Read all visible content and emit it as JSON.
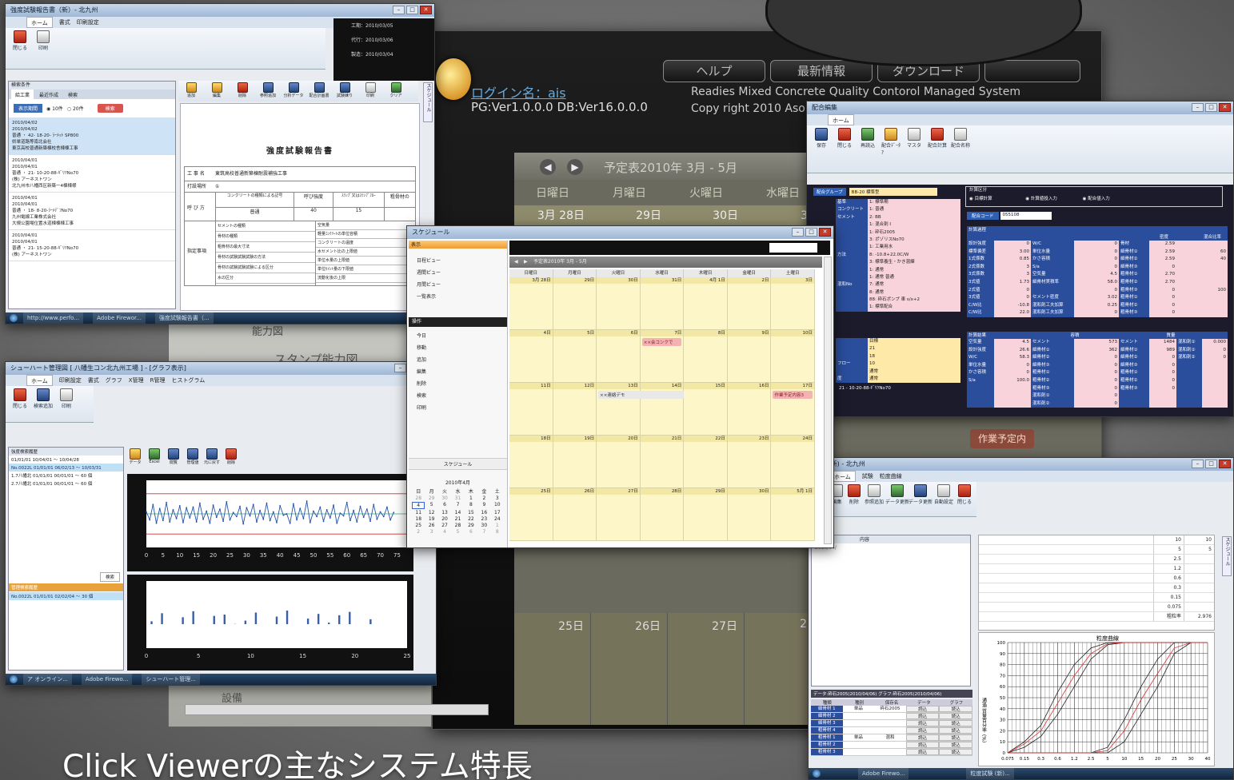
{
  "caption": "Click Viewerの主なシステム特長",
  "main_app": {
    "nav": [
      "ヘルプ",
      "最新情報",
      "ダウンロード"
    ],
    "login": "ログイン名：ais",
    "version": "PG:Ver1.0.0.0 DB:Ver16.0.0.0",
    "system_name": "Readies Mixed Concrete Quality Contorol Managed System",
    "copyright": "Copy right 2010 Aso",
    "schedule_title": "予定表2010年 3月 - 5月",
    "weekdays": [
      "日曜日",
      "月曜日",
      "火曜日",
      "水曜日"
    ],
    "dates_top": [
      "3月 28日",
      "29日",
      "30日",
      "31"
    ],
    "dates_bottom": [
      "25日",
      "26日",
      "27日",
      "28"
    ],
    "stamp_label": "スタンプ能力図",
    "side_label1": "能力図",
    "side_label2": "設備",
    "work_button": "作業予定内"
  },
  "report_win": {
    "title": "強度試験報告書（新）- 北九州",
    "tabs": [
      "ホーム",
      "書式",
      "印刷設定"
    ],
    "btns": [
      "閉じる",
      "印刷"
    ],
    "meta": [
      "工期：2010/03/05",
      "代行：2010/03/06",
      "製造：2010/03/04"
    ],
    "list_tabs": [
      "給工業",
      "最近作成",
      "検索"
    ],
    "filter_btn": "表示期間",
    "radio": [
      "10件",
      "20件"
    ],
    "search": "検索",
    "entries": [
      [
        "2010/04/02",
        "2010/04/02",
        "普通 ・ 42- 18-20- ﾗｰﾒｯﾄ SP800",
        "県単道路等南北会社",
        "東京高校普通新築棟校舎棟棟工事"
      ],
      [
        "2010/04/01",
        "2010/04/01",
        "普通 ・ 21- 10-20-88-ｷﾞﾘﾂNo70",
        "(株) アーネストワン",
        "北九州市八幡西区新築一4棟棟様"
      ],
      [
        "2010/04/01",
        "2010/04/01",
        "普通 ・ 18- 8-20-ﾗｰﾒﾃﾞﾌNo70",
        "九州電線工業株式会社",
        "大規公園場位置水道棟棟棟工事"
      ],
      [
        "2010/04/01",
        "2010/04/01",
        "普通 ・ 21- 15-20-88-ｷﾞﾘﾂNo70",
        "(株) アーネストワン"
      ]
    ],
    "toolbar": [
      "追加",
      "編集",
      "削除",
      "参照追加",
      "分析データ",
      "配合計画書",
      "試験練り",
      "印刷",
      "クリア"
    ],
    "doc_title": "強度試験報告書",
    "rows": [
      [
        "工 事 名",
        "東筑高校普通新築棟耐震補強工事"
      ],
      [
        "打設場所",
        "①"
      ]
    ],
    "col_heads": [
      "コンクリートの種類による記号",
      "呼び強度",
      "ｽﾗﾝﾌﾟ又はｽﾗﾝﾌﾟﾌﾛｰ",
      "粗骨材の"
    ],
    "col_vals": [
      "普通",
      "40",
      "15"
    ],
    "spec_label": "呼 び 方",
    "spec_rows": [
      "セメントの種類",
      "骨材の種類",
      "粗骨材の最大寸法",
      "骨材の試験試験試験の方法",
      "骨材の試験試験試験による区分",
      "水の区分"
    ],
    "spec_rows2": [
      "空気量",
      "軽量ｺﾝｸﾘｰﾄの単位容積",
      "コンクリートの温度",
      "水セメント比の上限値",
      "単位水量の上限値",
      "単位ｾﾒﾝﾄ量の下限値",
      "流動化後の上限"
    ],
    "extra_label": "指定事項",
    "side_tab": "スケジュール",
    "status": [
      "http://www.perfo...",
      "Adobe Firewor...",
      "強度試験報告書（..."
    ]
  },
  "schedule_win": {
    "title": "スケジュール",
    "views": [
      "日程ビュー",
      "週間ビュー",
      "月間ビュー",
      "一覧表示"
    ],
    "ops_label": "操作",
    "ops": [
      "今日",
      "移動",
      "追加",
      "編集",
      "削除",
      "検索",
      "印刷"
    ],
    "schedule_label": "スケジュール",
    "range": "予定表2010年 3月 - 5月",
    "weekdays": [
      "日曜日",
      "月曜日",
      "火曜日",
      "水曜日",
      "木曜日",
      "金曜日",
      "土曜日"
    ],
    "weeks": [
      [
        "3月 28日",
        "29日",
        "30日",
        "31日",
        "4月 1日",
        "2日",
        "3日"
      ],
      [
        "4日",
        "5日",
        "6日",
        "7日",
        "8日",
        "9日",
        "10日"
      ],
      [
        "11日",
        "12日",
        "13日",
        "14日",
        "15日",
        "16日",
        "17日"
      ],
      [
        "18日",
        "19日",
        "20日",
        "21日",
        "22日",
        "23日",
        "24日"
      ],
      [
        "25日",
        "26日",
        "27日",
        "28日",
        "29日",
        "30日",
        "5月 1日"
      ]
    ],
    "events": [
      "××会コンクで",
      "××連絡デモ",
      "作業予定内容3"
    ],
    "mini_month": "2010年4月",
    "mini_head": [
      "日",
      "月",
      "火",
      "水",
      "木",
      "金",
      "土"
    ],
    "mini_days": [
      [
        "28",
        "29",
        "30",
        "31",
        "1",
        "2",
        "3"
      ],
      [
        "4",
        "5",
        "6",
        "7",
        "8",
        "9",
        "10"
      ],
      [
        "11",
        "12",
        "13",
        "14",
        "15",
        "16",
        "17"
      ],
      [
        "18",
        "19",
        "20",
        "21",
        "22",
        "23",
        "24"
      ],
      [
        "25",
        "26",
        "27",
        "28",
        "29",
        "30",
        "1"
      ],
      [
        "2",
        "3",
        "4",
        "5",
        "6",
        "7",
        "8"
      ]
    ]
  },
  "chart_win": {
    "title": "シューハート管理図 [ 八幡生コン北九州工場 ] - [グラフ表示]",
    "tabs": [
      "ホーム",
      "印刷設定",
      "書式",
      "グラフ",
      "X管理",
      "R管理",
      "ヒストグラム"
    ],
    "btns": [
      "閉じる",
      "検索追加",
      "印刷"
    ],
    "panel_title": "強度検索履歴",
    "history": [
      "01/01/01 10/04/01 ～ 10/04/28",
      "No.0022L 01/01/01 06/02/13 ～ 10/03/31",
      "1.7八幡北 01/01/01 00/01/01 ～ 60 個",
      "2.7八幡北 01/01/01 00/01/01 ～ 60 個"
    ],
    "search_btn": "検索",
    "panel2_title": "管理検索履歴",
    "history2": [
      "No.0022L 01/01/01 02/02/04 ～ 30 個"
    ],
    "toolbar": [
      "データ",
      "Excel",
      "閲覧",
      "管理値",
      "元に戻す",
      "削除"
    ],
    "status": [
      "ア オンライン...",
      "Adobe Firewo...",
      "シューハート管理..."
    ]
  },
  "mix_win": {
    "title": "配合編集",
    "tabs": [
      "ホーム"
    ],
    "btns": [
      "保存",
      "閉じる",
      "再読込",
      "配合ﾃﾞｰﾀｱ",
      "マスタ",
      "配合計算",
      "配合名称"
    ],
    "group_label": "配合グループ",
    "group_value": "BB-20 標準型",
    "calc_label": "計算区分",
    "calc_opts": [
      "目標計算",
      "計算値投入力",
      "配合値入力"
    ],
    "code_label": "配合コード",
    "code_value": "055108",
    "left_labels": [
      "基準",
      "コンクリート",
      "セメント",
      "",
      "",
      "",
      "",
      "方法",
      "",
      "",
      "",
      "混和No",
      ""
    ],
    "left_values": [
      "1: 標準期",
      "1: 普通",
      "2: BB",
      "1: 混合剤 I",
      "1: 砕石2005",
      "3: ポゾリスNo70",
      "1: 工業用水",
      "8: -10.8+22.0C/W",
      "3: 標準養生・かき混練",
      "1: 通常",
      "1: 通常 普通",
      "7: 通常",
      "8: 通常",
      "88: 砕石ポンプ 車 s/x+2",
      "1: 標準配合"
    ],
    "lower_labels": [
      "",
      "",
      "",
      "フロー",
      "",
      "度"
    ],
    "lower_values": [
      "目標",
      "21",
      "18",
      "10",
      "通常",
      "通常"
    ],
    "lower_name": "21 - 10-20-88-ｷﾞﾘﾂNo70",
    "table1_head": "計算過程",
    "table1_labels": [
      "設計強度",
      "標準偏差",
      "1式係数",
      "2式係数",
      "3式係数",
      "3式値",
      "2式値",
      "3式値",
      "C/W比",
      "C/W比"
    ],
    "table1_vals": [
      "0",
      "3.00",
      "0.85",
      "3",
      "3",
      "1.73",
      "0",
      "0",
      "-10.8",
      "22.0"
    ],
    "table1_mid": [
      "W/C",
      "単位水量",
      "かさ容積",
      "S/a",
      "空気量",
      "細骨材実積率",
      "",
      "セメント密度",
      "混和剤工夫加算",
      "混和剤工夫加算"
    ],
    "table1_mid_vals": [
      "0",
      "0",
      "0",
      "0",
      "4.5",
      "58.0",
      "0",
      "3.02",
      "0.25",
      "0"
    ],
    "table1_right": [
      "骨材",
      "細骨材①",
      "細骨材②",
      "細骨材③",
      "粗骨材①",
      "粗骨材②",
      "粗骨材③",
      "粗骨材①",
      "粗骨材②",
      "粗骨材③"
    ],
    "table1_dens": [
      "2.59",
      "2.59",
      "2.59",
      "0",
      "2.70",
      "2.70",
      "0",
      "0",
      "0",
      "0"
    ],
    "table1_ratio": [
      "",
      "60",
      "40",
      "",
      "",
      "",
      "100",
      "",
      "",
      ""
    ],
    "table1_cols": [
      "密度",
      "混合比率"
    ],
    "table2_head": "計算結果",
    "table2_cols": [
      "容積",
      "質量"
    ],
    "table2_labels": [
      "空気量",
      "設計強度",
      "W/C",
      "単位水量",
      "かさ容積",
      "S/a"
    ],
    "table2_vals": [
      "4.5",
      "26.6",
      "58.3",
      "0",
      "0",
      "100.0"
    ],
    "table2_mid": [
      "セメント",
      "細骨材①",
      "細骨材②",
      "細骨材③",
      "粗骨材①",
      "粗骨材②",
      "粗骨材③",
      "混和剤①",
      "混和剤②"
    ],
    "table2_mid_vals": [
      "573",
      "362",
      "0",
      "0",
      "0",
      "0",
      "0",
      "0",
      "0"
    ],
    "table2_right": [
      "セメント",
      "細骨材①",
      "細骨材②",
      "細骨材③",
      "粗骨材①",
      "粗骨材②",
      "粗骨材③"
    ],
    "table2_right_vals": [
      "1484",
      "989",
      "0",
      "0",
      "0",
      "0",
      "0"
    ],
    "table2_far": [
      "混和剤①",
      "混和剤①",
      "混和剤②"
    ],
    "table2_far_vals": [
      "0.000",
      "0",
      "0"
    ]
  },
  "sieve_win": {
    "title": "試験 (新) - 北九州",
    "tabs": [
      "ホーム",
      "試験",
      "粒度曲線"
    ],
    "btns": [
      "追加",
      "編集",
      "削除",
      "参照追加",
      "データ更新",
      "データ更新",
      "自動設定",
      "閉じる"
    ],
    "list_head": [
      "",
      "内容"
    ],
    "list_date": "2010/04/",
    "data_caption": "データ:砕石2005(2010/04/06) グラフ:砕石2005(2010/04/06)",
    "grid_cols": [
      "種類",
      "種別",
      "保存名",
      "データ",
      "グラフ"
    ],
    "grid_rows": [
      [
        "細骨材 1",
        "単品",
        "砕石2005",
        "読込",
        "読込"
      ],
      [
        "細骨材 2",
        "",
        "",
        "読込",
        "読込"
      ],
      [
        "細骨材 3",
        "",
        "",
        "読込",
        "読込"
      ],
      [
        "粗骨材 4",
        "",
        "",
        "読込",
        "読込"
      ],
      [
        "粗骨材 1",
        "単品",
        "混和",
        "読込",
        "読込"
      ],
      [
        "粗骨材 2",
        "",
        "",
        "読込",
        "読込"
      ],
      [
        "粗骨材 3",
        "",
        "",
        "読込",
        "読込"
      ]
    ],
    "table_vals": [
      [
        "10",
        "10"
      ],
      [
        "5",
        "5"
      ],
      [
        "2.5",
        ""
      ],
      [
        "1.2",
        ""
      ],
      [
        "0.6",
        ""
      ],
      [
        "0.3",
        ""
      ],
      [
        "0.15",
        ""
      ],
      [
        "0.075",
        ""
      ],
      [
        "粗粒率",
        "2.976"
      ]
    ],
    "side_tab": "スケジュール",
    "status": [
      "Adobe Firewo...",
      "粒度試験 (新)..."
    ]
  },
  "chart_data": [
    {
      "type": "line",
      "title": "",
      "xlabel": "",
      "ylabel": "",
      "x": [
        0,
        5,
        10,
        15,
        20,
        25,
        30,
        35,
        40,
        45,
        50,
        55,
        60,
        65,
        70,
        75
      ],
      "xlim": [
        0,
        78
      ],
      "ylim": [
        0,
        10
      ],
      "series": [
        {
          "values": [
            5.3,
            4.1,
            6.4,
            3.6,
            5.8,
            4.0,
            6.7,
            3.8,
            5.6,
            4.3,
            6.2,
            3.7,
            5.9,
            4.4,
            6.0,
            3.8,
            6.6,
            4.2,
            5.4,
            3.6,
            6.3,
            4.5,
            5.7,
            3.9,
            6.8,
            4.1,
            5.2,
            4.6,
            6.1,
            3.5,
            5.9,
            4.7,
            6.4,
            3.8,
            5.5,
            4.2,
            6.6,
            4.0,
            5.3,
            3.7,
            6.2,
            4.8,
            5.0,
            3.6,
            6.5,
            4.1,
            5.8,
            4.3,
            6.9,
            3.7,
            5.4,
            4.6,
            6.0,
            3.9,
            5.6,
            4.4,
            6.3,
            3.6,
            5.1,
            4.7,
            6.7,
            4.0,
            5.5,
            3.8,
            6.1,
            4.5,
            5.7,
            3.9,
            6.4,
            4.2,
            5.3,
            4.6,
            6.0,
            4.1,
            5.2
          ]
        }
      ],
      "ref_lines": [
        2.0,
        5.0,
        8.0
      ]
    },
    {
      "type": "bar",
      "title": "",
      "xlabel": "",
      "ylabel": "",
      "x": [
        0,
        5,
        10,
        15,
        20,
        25
      ],
      "xlim": [
        0,
        25
      ],
      "ylim": [
        0,
        10
      ],
      "series": [
        {
          "values": [
            4.0,
            5.2,
            3.2,
            4.6,
            5.5,
            3.4,
            4.8,
            5.0,
            3.6,
            4.1,
            5.3,
            3.3,
            4.7,
            5.6,
            3.5,
            4.4,
            5.1,
            3.8,
            4.9,
            5.4,
            3.1,
            4.3
          ]
        }
      ]
    },
    {
      "type": "line",
      "title": "粒度曲線",
      "ylabel": "通過 質量百分率 (%)",
      "xlabel": "",
      "categories": [
        "0.075",
        "0.15",
        "0.3",
        "0.6",
        "1.2",
        "2.5",
        "5",
        "10",
        "15",
        "20",
        "25",
        "30",
        "40"
      ],
      "ylim": [
        0,
        100
      ],
      "yticks": [
        0,
        10,
        20,
        30,
        40,
        50,
        60,
        70,
        80,
        90,
        100
      ],
      "series": [
        {
          "values": [
            0,
            10,
            25,
            55,
            80,
            95,
            100,
            100,
            100,
            100,
            100,
            100,
            100
          ]
        },
        {
          "values": [
            0,
            5,
            15,
            35,
            60,
            85,
            98,
            100,
            100,
            100,
            100,
            100,
            100
          ]
        },
        {
          "values": [
            0,
            8,
            20,
            45,
            70,
            90,
            99,
            100,
            100,
            100,
            100,
            100,
            100
          ]
        },
        {
          "values": [
            0,
            0,
            0,
            0,
            0,
            0,
            5,
            30,
            60,
            85,
            100,
            100,
            100
          ]
        },
        {
          "values": [
            0,
            0,
            0,
            0,
            0,
            0,
            0,
            10,
            35,
            60,
            90,
            100,
            100
          ]
        },
        {
          "values": [
            0,
            0,
            0,
            0,
            0,
            0,
            2,
            20,
            48,
            72,
            95,
            100,
            100
          ]
        }
      ]
    }
  ]
}
